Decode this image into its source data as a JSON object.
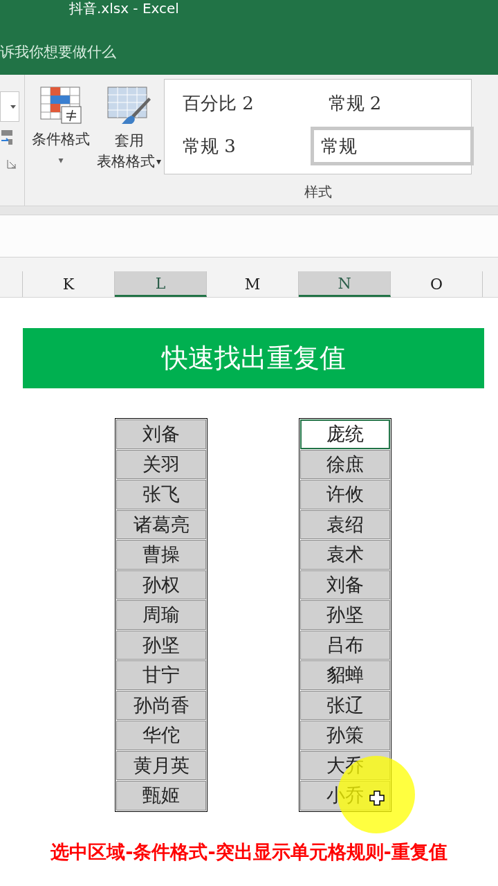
{
  "window": {
    "title": "抖音.xlsx  -  Excel",
    "tell_me": "诉我你想要做什么"
  },
  "ribbon": {
    "buttons": [
      {
        "kind": "conditional",
        "label": "条件格式",
        "dropdown": "▾"
      },
      {
        "kind": "table",
        "label": "套用",
        "label_2": "表格格式",
        "dropdown": "▾"
      }
    ],
    "styles": [
      {
        "label": "百分比 2",
        "selected": false
      },
      {
        "label": "常规 2",
        "selected": false
      },
      {
        "label": "常规 3",
        "selected": false
      },
      {
        "label": "常规",
        "selected": true
      }
    ],
    "group_label": "样式"
  },
  "columns": [
    {
      "label": "K",
      "selected": false
    },
    {
      "label": "L",
      "selected": true
    },
    {
      "label": "M",
      "selected": false
    },
    {
      "label": "N",
      "selected": true
    },
    {
      "label": "O",
      "selected": false
    }
  ],
  "banner": "快速找出重复值",
  "list_1": [
    {
      "text": "刘备",
      "selected": false
    },
    {
      "text": "关羽",
      "selected": false
    },
    {
      "text": "张飞",
      "selected": false
    },
    {
      "text": "诸葛亮",
      "selected": false
    },
    {
      "text": "曹操",
      "selected": false
    },
    {
      "text": "孙权",
      "selected": false
    },
    {
      "text": "周瑜",
      "selected": false
    },
    {
      "text": "孙坚",
      "selected": false
    },
    {
      "text": "甘宁",
      "selected": false
    },
    {
      "text": "孙尚香",
      "selected": false
    },
    {
      "text": "华佗",
      "selected": false
    },
    {
      "text": "黄月英",
      "selected": false
    },
    {
      "text": "甄姬",
      "selected": false
    }
  ],
  "list_2": [
    {
      "text": "庞统",
      "selected": true
    },
    {
      "text": "徐庶",
      "selected": false
    },
    {
      "text": "许攸",
      "selected": false
    },
    {
      "text": "袁绍",
      "selected": false
    },
    {
      "text": "袁术",
      "selected": false
    },
    {
      "text": "刘备",
      "selected": false
    },
    {
      "text": "孙坚",
      "selected": false
    },
    {
      "text": "吕布",
      "selected": false
    },
    {
      "text": "貂蝉",
      "selected": false
    },
    {
      "text": "张辽",
      "selected": false
    },
    {
      "text": "孙策",
      "selected": false
    },
    {
      "text": "大乔",
      "selected": false
    },
    {
      "text": "小乔",
      "selected": false
    }
  ],
  "caption": "选中区域-条件格式-突出显示单元格规则-重复值"
}
